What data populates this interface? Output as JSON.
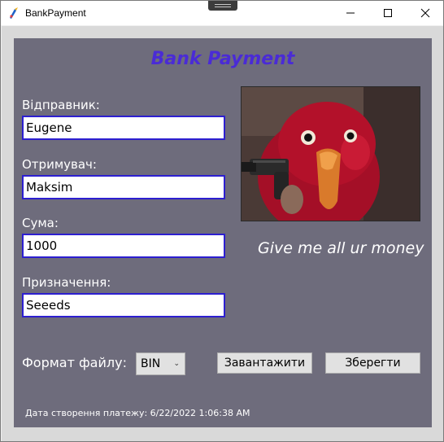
{
  "window": {
    "title": "BankPayment",
    "controls": {
      "minimize": "—",
      "maximize": "☐",
      "close": "✕"
    }
  },
  "form": {
    "heading": "Bank Payment",
    "sender": {
      "label": "Відправник:",
      "value": "Eugene"
    },
    "recipient": {
      "label": "Отримувач:",
      "value": "Maksim"
    },
    "amount": {
      "label": "Сума:",
      "value": "1000"
    },
    "purpose": {
      "label": "Призначення:",
      "value": "Seeeds"
    },
    "caption": "Give me all ur money",
    "file_format": {
      "label": "Формат файлу:",
      "selected": "BIN"
    },
    "buttons": {
      "load": "Завантажити",
      "save": "Зберегти"
    },
    "created_at": "Дата створення платежу: 6/22/2022 1:06:38 AM"
  },
  "colors": {
    "panel": "#6e6c7c",
    "heading": "#4a2bd6",
    "field_border": "#2d1fd0",
    "parrot": "#b3112a",
    "beak": "#d97a2b"
  },
  "icons": {
    "app": "bank-app-icon",
    "format_chevron": "chevron-down-icon"
  }
}
